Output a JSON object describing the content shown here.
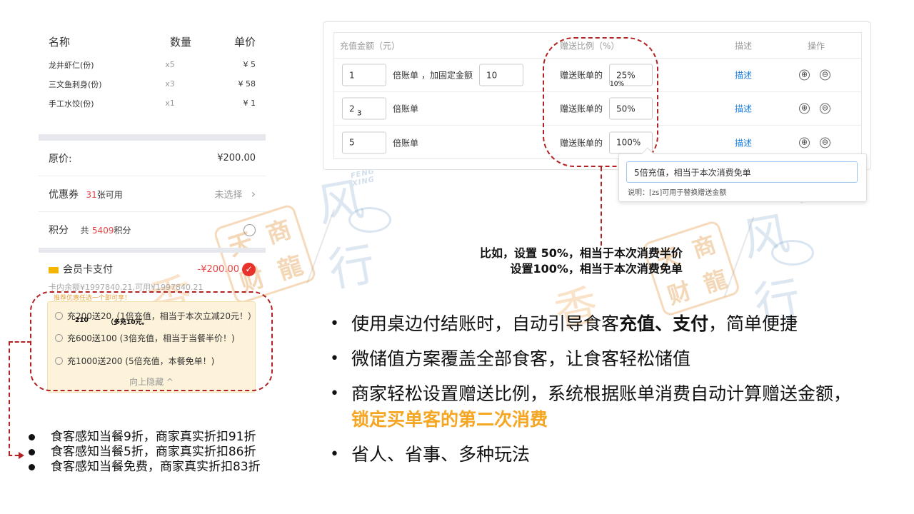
{
  "order": {
    "headers": [
      "名称",
      "数量",
      "单价"
    ],
    "items": [
      {
        "name": "龙井虾仁(份)",
        "qty": "x5",
        "price": "¥ 5"
      },
      {
        "name": "三文鱼刺身(份)",
        "qty": "x3",
        "price": "¥ 58"
      },
      {
        "name": "手工水饺(份)",
        "qty": "x1",
        "price": "¥ 1"
      }
    ]
  },
  "summary": {
    "original_label": "原价:",
    "original_value": "¥200.00",
    "coupon_label": "优惠券",
    "coupon_count": "31",
    "coupon_suffix": "张可用",
    "coupon_status": "未选择",
    "points_label": "积分",
    "points_prefix": "共",
    "points_value": "5409",
    "points_suffix": "积分"
  },
  "card_pay": {
    "label": "会员卡支付",
    "amount": "-¥200.00",
    "balance": "卡内余额¥1997840.21,可用¥1997840.21"
  },
  "recharge": {
    "hint": "推荐优惠任选一个即可享！",
    "options": [
      "充200送20（1倍充值，相当于本次立减20元！）",
      "充600送100 (3倍充值，相当于当餐半价！)",
      "充1000送200 (5倍充值，本餐免单！)"
    ],
    "collapse": "向上隐藏 ^",
    "overlay_a": "210",
    "overlay_b": "（多充10元。"
  },
  "left_notes": [
    "食客感知当餐9折，商家真实折扣91折",
    "食客感知当餐5折，商家真实折扣86折",
    "食客感知当餐免费，商家真实折扣83折"
  ],
  "settings": {
    "headers": {
      "amount": "充值金额（元）",
      "ratio": "赠送比例（%）",
      "desc": "描述",
      "ops": "操作"
    },
    "rows": [
      {
        "multiple": "1",
        "multiple_label": "倍账单",
        "fixed_label": "，加固定金额",
        "fixed": "10",
        "ratio_label": "赠送账单的",
        "ratio": "25%",
        "desc": "描述",
        "overlay": "10%"
      },
      {
        "multiple": "2",
        "multiple_label": "倍账单",
        "ratio_label": "赠送账单的",
        "ratio": "50%",
        "desc": "描述",
        "overlay": "3"
      },
      {
        "multiple": "5",
        "multiple_label": "倍账单",
        "ratio_label": "赠送账单的",
        "ratio": "100%",
        "desc": "描述"
      }
    ],
    "add_icon": "⊕",
    "remove_icon": "⊖"
  },
  "popover": {
    "input_value": "5倍充值，相当于本次消费免单",
    "note": "说明：[zs]可用于替换赠送金额"
  },
  "example": {
    "line1": "比如，设置  50%，相当于本次消费半价",
    "line2": "设置100%，相当于本次消费免单"
  },
  "bullets": {
    "b1_pre": "使用桌边付结账时，自动引导食客",
    "b1_bold": "充值、支付",
    "b1_post": "，简单便捷",
    "b2": "微储值方案覆盖全部食客，让食客轻松储值",
    "b3_line1": "商家轻松设置赠送比例，系统根据账单消费自动计算赠送金额，",
    "b3_line2": "锁定买单客的第二次消费",
    "b4": "省人、省事、多种玩法"
  },
  "watermarks": {
    "seal_chars": [
      "天",
      "商",
      "财",
      "龍"
    ],
    "brand_text": "FENG XING",
    "big_chars": "风行",
    "orange_char": "香"
  },
  "colors": {
    "accent_red": "#e7332b",
    "link_blue": "#1a7de0",
    "highlight_orange": "#f5a623",
    "dash_red": "#b22222"
  }
}
